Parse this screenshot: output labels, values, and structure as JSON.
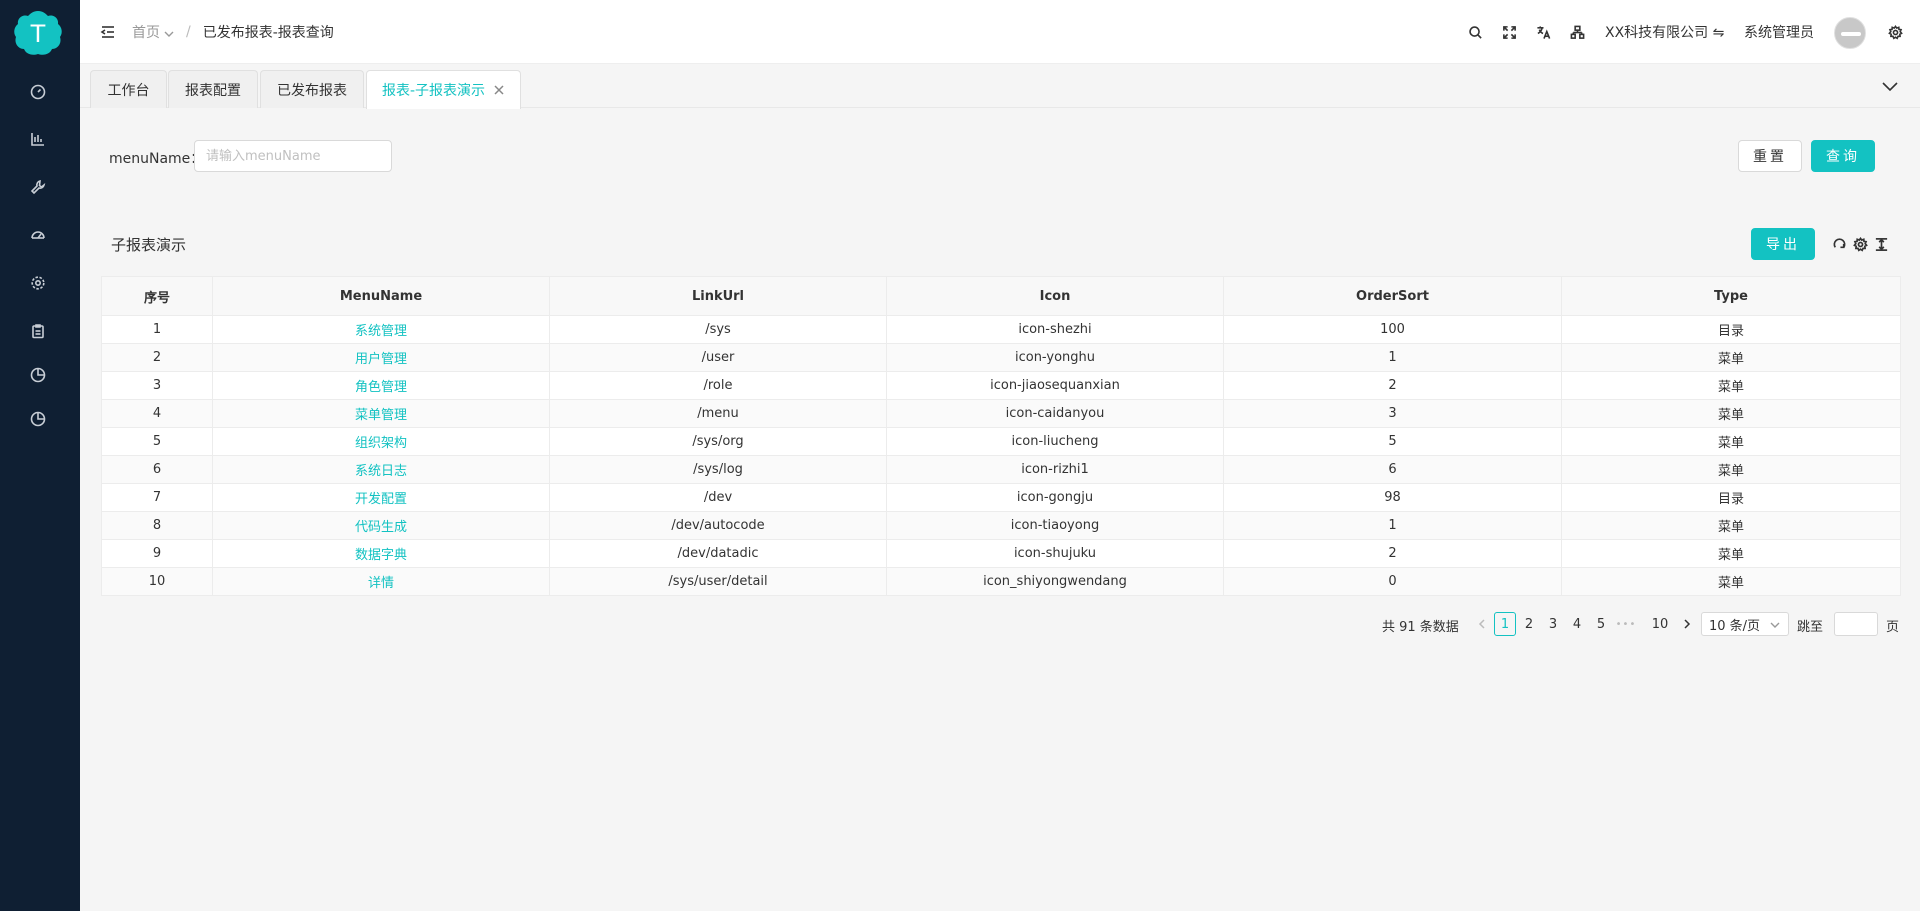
{
  "sidebar": {
    "logo_letter": "T",
    "brand_color": "#13c2c2",
    "nav_icons": [
      "dashboard-icon",
      "bar-chart-icon",
      "wrench-icon",
      "gauge-icon",
      "settings-icon",
      "clipboard-icon",
      "pie-chart-icon",
      "pie-chart-icon"
    ]
  },
  "header": {
    "breadcrumb": {
      "home": "首页",
      "separator": "/",
      "current": "已发布报表-报表查询"
    },
    "company": "XX科技有限公司 ⇋",
    "user": "系统管理员"
  },
  "tabs": [
    {
      "label": "工作台"
    },
    {
      "label": "报表配置"
    },
    {
      "label": "已发布报表"
    },
    {
      "label": "报表-子报表演示",
      "active": true
    }
  ],
  "search": {
    "label": "menuName：",
    "placeholder": "请输入menuName",
    "reset_label": "重置",
    "query_label": "查询"
  },
  "table": {
    "title": "子报表演示",
    "export_label": "导出",
    "columns": [
      "序号",
      "MenuName",
      "LinkUrl",
      "Icon",
      "OrderSort",
      "Type"
    ],
    "rows": [
      [
        "1",
        "系统管理",
        "/sys",
        "icon-shezhi",
        "100",
        "目录"
      ],
      [
        "2",
        "用户管理",
        "/user",
        "icon-yonghu",
        "1",
        "菜单"
      ],
      [
        "3",
        "角色管理",
        "/role",
        "icon-jiaosequanxian",
        "2",
        "菜单"
      ],
      [
        "4",
        "菜单管理",
        "/menu",
        "icon-caidanyou",
        "3",
        "菜单"
      ],
      [
        "5",
        "组织架构",
        "/sys/org",
        "icon-liucheng",
        "5",
        "菜单"
      ],
      [
        "6",
        "系统日志",
        "/sys/log",
        "icon-rizhi1",
        "6",
        "菜单"
      ],
      [
        "7",
        "开发配置",
        "/dev",
        "icon-gongju",
        "98",
        "目录"
      ],
      [
        "8",
        "代码生成",
        "/dev/autocode",
        "icon-tiaoyong",
        "1",
        "菜单"
      ],
      [
        "9",
        "数据字典",
        "/dev/datadic",
        "icon-shujuku",
        "2",
        "菜单"
      ],
      [
        "10",
        "详情",
        "/sys/user/detail",
        "icon_shiyongwendang",
        "0",
        "菜单"
      ]
    ]
  },
  "pagination": {
    "total_text": "共 91 条数据",
    "pages": [
      "1",
      "2",
      "3",
      "4",
      "5"
    ],
    "ellipsis": "•••",
    "last_page": "10",
    "current_page": "1",
    "page_size": "10 条/页",
    "jump_label": "跳至",
    "jump_suffix": "页"
  }
}
